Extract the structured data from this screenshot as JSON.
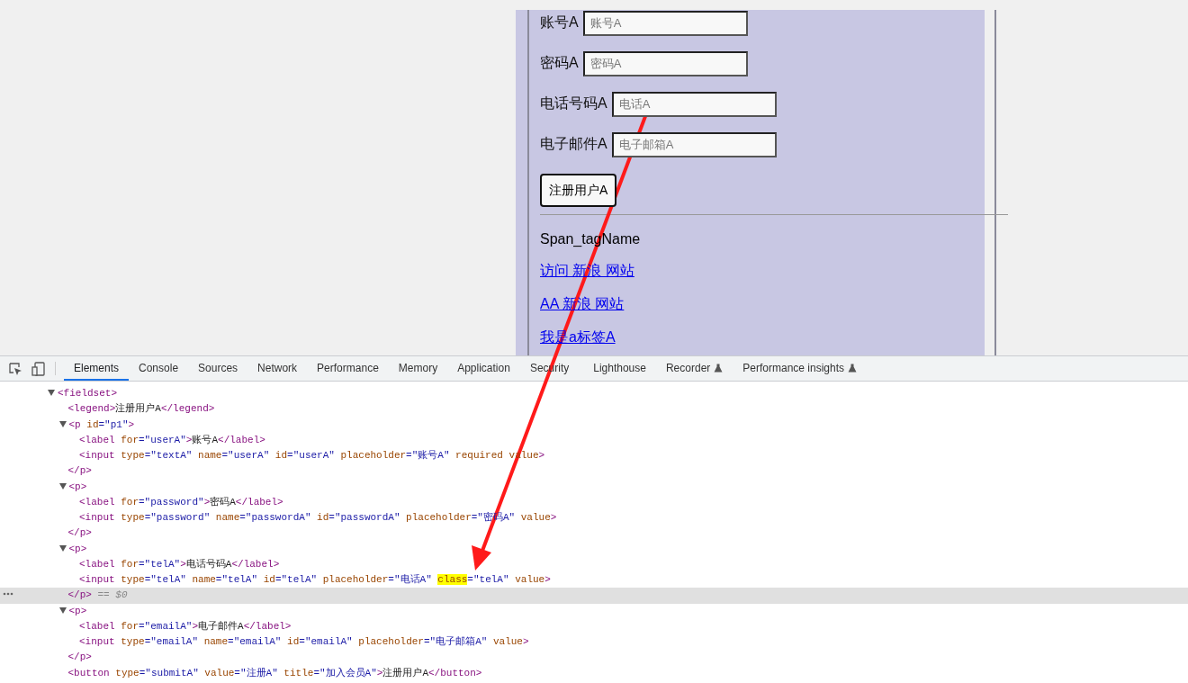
{
  "page": {
    "fields": [
      {
        "label": "账号A",
        "placeholder": "账号A"
      },
      {
        "label": "密码A",
        "placeholder": "密码A"
      },
      {
        "label": "电话号码A",
        "placeholder": "电话A"
      },
      {
        "label": "电子邮件A",
        "placeholder": "电子邮箱A"
      }
    ],
    "submit_button": "注册用户A",
    "span_text": "Span_tagName",
    "links": [
      "访问 新浪 网站",
      "AA 新浪 网站",
      "我是a标签A"
    ]
  },
  "devtools": {
    "tabs": [
      {
        "label": "Elements",
        "selected": true,
        "experimental": false
      },
      {
        "label": "Console",
        "selected": false,
        "experimental": false
      },
      {
        "label": "Sources",
        "selected": false,
        "experimental": false
      },
      {
        "label": "Network",
        "selected": false,
        "experimental": false
      },
      {
        "label": "Performance",
        "selected": false,
        "experimental": false
      },
      {
        "label": "Memory",
        "selected": false,
        "experimental": false
      },
      {
        "label": "Application",
        "selected": false,
        "experimental": false
      },
      {
        "label": "Security",
        "selected": false,
        "experimental": false
      },
      {
        "label": "Lighthouse",
        "selected": false,
        "experimental": false
      },
      {
        "label": "Recorder",
        "selected": false,
        "experimental": true
      },
      {
        "label": "Performance insights",
        "selected": false,
        "experimental": true
      }
    ],
    "dom_tree": [
      {
        "expanded": true,
        "line": {
          "selected": false,
          "tokens": [
            {
              "kind": "tag",
              "text": "<fieldset>"
            }
          ]
        },
        "children": [
          {
            "line": {
              "selected": false,
              "tokens": [
                {
                  "kind": "tag",
                  "text": "<legend>"
                },
                {
                  "kind": "text",
                  "text": "注册用户A"
                },
                {
                  "kind": "tag",
                  "text": "</legend>"
                }
              ]
            }
          },
          {
            "expanded": true,
            "line": {
              "selected": false,
              "tokens": [
                {
                  "kind": "tag",
                  "text": "<p"
                },
                {
                  "kind": "attr",
                  "text": " id"
                },
                {
                  "kind": "value",
                  "text": "=\"p1\""
                },
                {
                  "kind": "tag",
                  "text": ">"
                }
              ]
            },
            "children": [
              {
                "line": {
                  "selected": false,
                  "tokens": [
                    {
                      "kind": "tag",
                      "text": "<label"
                    },
                    {
                      "kind": "attr",
                      "text": " for"
                    },
                    {
                      "kind": "value",
                      "text": "=\"userA\""
                    },
                    {
                      "kind": "tag",
                      "text": ">"
                    },
                    {
                      "kind": "text",
                      "text": "账号A"
                    },
                    {
                      "kind": "tag",
                      "text": "</label>"
                    }
                  ]
                }
              },
              {
                "line": {
                  "selected": false,
                  "tokens": [
                    {
                      "kind": "tag",
                      "text": "<input"
                    },
                    {
                      "kind": "attr",
                      "text": " type"
                    },
                    {
                      "kind": "value",
                      "text": "=\"textA\""
                    },
                    {
                      "kind": "attr",
                      "text": " name"
                    },
                    {
                      "kind": "value",
                      "text": "=\"userA\""
                    },
                    {
                      "kind": "attr",
                      "text": " id"
                    },
                    {
                      "kind": "value",
                      "text": "=\"userA\""
                    },
                    {
                      "kind": "attr",
                      "text": " placeholder"
                    },
                    {
                      "kind": "value",
                      "text": "=\"账号A\""
                    },
                    {
                      "kind": "attr",
                      "text": " required value"
                    },
                    {
                      "kind": "tag",
                      "text": ">"
                    }
                  ]
                }
              }
            ],
            "close": {
              "selected": false,
              "tokens": [
                {
                  "kind": "tag",
                  "text": "</p>"
                }
              ]
            }
          },
          {
            "expanded": true,
            "line": {
              "selected": false,
              "tokens": [
                {
                  "kind": "tag",
                  "text": "<p>"
                }
              ]
            },
            "children": [
              {
                "line": {
                  "selected": false,
                  "tokens": [
                    {
                      "kind": "tag",
                      "text": "<label"
                    },
                    {
                      "kind": "attr",
                      "text": " for"
                    },
                    {
                      "kind": "value",
                      "text": "=\"password\""
                    },
                    {
                      "kind": "tag",
                      "text": ">"
                    },
                    {
                      "kind": "text",
                      "text": "密码A"
                    },
                    {
                      "kind": "tag",
                      "text": "</label>"
                    }
                  ]
                }
              },
              {
                "line": {
                  "selected": false,
                  "tokens": [
                    {
                      "kind": "tag",
                      "text": "<input"
                    },
                    {
                      "kind": "attr",
                      "text": " type"
                    },
                    {
                      "kind": "value",
                      "text": "=\"password\""
                    },
                    {
                      "kind": "attr",
                      "text": " name"
                    },
                    {
                      "kind": "value",
                      "text": "=\"passwordA\""
                    },
                    {
                      "kind": "attr",
                      "text": " id"
                    },
                    {
                      "kind": "value",
                      "text": "=\"passwordA\""
                    },
                    {
                      "kind": "attr",
                      "text": " placeholder"
                    },
                    {
                      "kind": "value",
                      "text": "=\"密码A\""
                    },
                    {
                      "kind": "attr",
                      "text": " value"
                    },
                    {
                      "kind": "tag",
                      "text": ">"
                    }
                  ]
                }
              }
            ],
            "close": {
              "selected": false,
              "tokens": [
                {
                  "kind": "tag",
                  "text": "</p>"
                }
              ]
            }
          },
          {
            "expanded": true,
            "line": {
              "selected": false,
              "tokens": [
                {
                  "kind": "tag",
                  "text": "<p>"
                }
              ]
            },
            "children": [
              {
                "line": {
                  "selected": false,
                  "tokens": [
                    {
                      "kind": "tag",
                      "text": "<label"
                    },
                    {
                      "kind": "attr",
                      "text": " for"
                    },
                    {
                      "kind": "value",
                      "text": "=\"telA\""
                    },
                    {
                      "kind": "tag",
                      "text": ">"
                    },
                    {
                      "kind": "text",
                      "text": "电话号码A"
                    },
                    {
                      "kind": "tag",
                      "text": "</label>"
                    }
                  ]
                }
              },
              {
                "line": {
                  "selected": false,
                  "tokens": [
                    {
                      "kind": "tag",
                      "text": "<input"
                    },
                    {
                      "kind": "attr",
                      "text": " type"
                    },
                    {
                      "kind": "value",
                      "text": "=\"telA\""
                    },
                    {
                      "kind": "attr",
                      "text": " name"
                    },
                    {
                      "kind": "value",
                      "text": "=\"telA\""
                    },
                    {
                      "kind": "attr",
                      "text": " id"
                    },
                    {
                      "kind": "value",
                      "text": "=\"telA\""
                    },
                    {
                      "kind": "attr",
                      "text": " placeholder"
                    },
                    {
                      "kind": "value",
                      "text": "=\"电话A\" "
                    },
                    {
                      "kind": "match",
                      "text": "class"
                    },
                    {
                      "kind": "value",
                      "text": "=\"telA\""
                    },
                    {
                      "kind": "attr",
                      "text": " value"
                    },
                    {
                      "kind": "tag",
                      "text": ">"
                    }
                  ]
                }
              }
            ],
            "close": {
              "selected": true,
              "tokens": [
                {
                  "kind": "tag",
                  "text": "</p>"
                },
                {
                  "kind": "hint",
                  "text": " == $0"
                }
              ]
            }
          },
          {
            "expanded": true,
            "line": {
              "selected": false,
              "tokens": [
                {
                  "kind": "tag",
                  "text": "<p>"
                }
              ]
            },
            "children": [
              {
                "line": {
                  "selected": false,
                  "tokens": [
                    {
                      "kind": "tag",
                      "text": "<label"
                    },
                    {
                      "kind": "attr",
                      "text": " for"
                    },
                    {
                      "kind": "value",
                      "text": "=\"emailA\""
                    },
                    {
                      "kind": "tag",
                      "text": ">"
                    },
                    {
                      "kind": "text",
                      "text": "电子邮件A"
                    },
                    {
                      "kind": "tag",
                      "text": "</label>"
                    }
                  ]
                }
              },
              {
                "line": {
                  "selected": false,
                  "tokens": [
                    {
                      "kind": "tag",
                      "text": "<input"
                    },
                    {
                      "kind": "attr",
                      "text": " type"
                    },
                    {
                      "kind": "value",
                      "text": "=\"emailA\""
                    },
                    {
                      "kind": "attr",
                      "text": " name"
                    },
                    {
                      "kind": "value",
                      "text": "=\"emailA\""
                    },
                    {
                      "kind": "attr",
                      "text": " id"
                    },
                    {
                      "kind": "value",
                      "text": "=\"emailA\""
                    },
                    {
                      "kind": "attr",
                      "text": " placeholder"
                    },
                    {
                      "kind": "value",
                      "text": "=\"电子邮箱A\""
                    },
                    {
                      "kind": "attr",
                      "text": " value"
                    },
                    {
                      "kind": "tag",
                      "text": ">"
                    }
                  ]
                }
              }
            ],
            "close": {
              "selected": false,
              "tokens": [
                {
                  "kind": "tag",
                  "text": "</p>"
                }
              ]
            }
          },
          {
            "line": {
              "selected": false,
              "tokens": [
                {
                  "kind": "tag",
                  "text": "<button"
                },
                {
                  "kind": "attr",
                  "text": " type"
                },
                {
                  "kind": "value",
                  "text": "=\"submitA\""
                },
                {
                  "kind": "attr",
                  "text": " value"
                },
                {
                  "kind": "value",
                  "text": "=\"注册A\""
                },
                {
                  "kind": "attr",
                  "text": " title"
                },
                {
                  "kind": "value",
                  "text": "=\"加入会员A\""
                },
                {
                  "kind": "tag",
                  "text": ">"
                },
                {
                  "kind": "text",
                  "text": "注册用户A"
                },
                {
                  "kind": "tag",
                  "text": "</button>"
                }
              ]
            }
          }
        ]
      }
    ]
  }
}
